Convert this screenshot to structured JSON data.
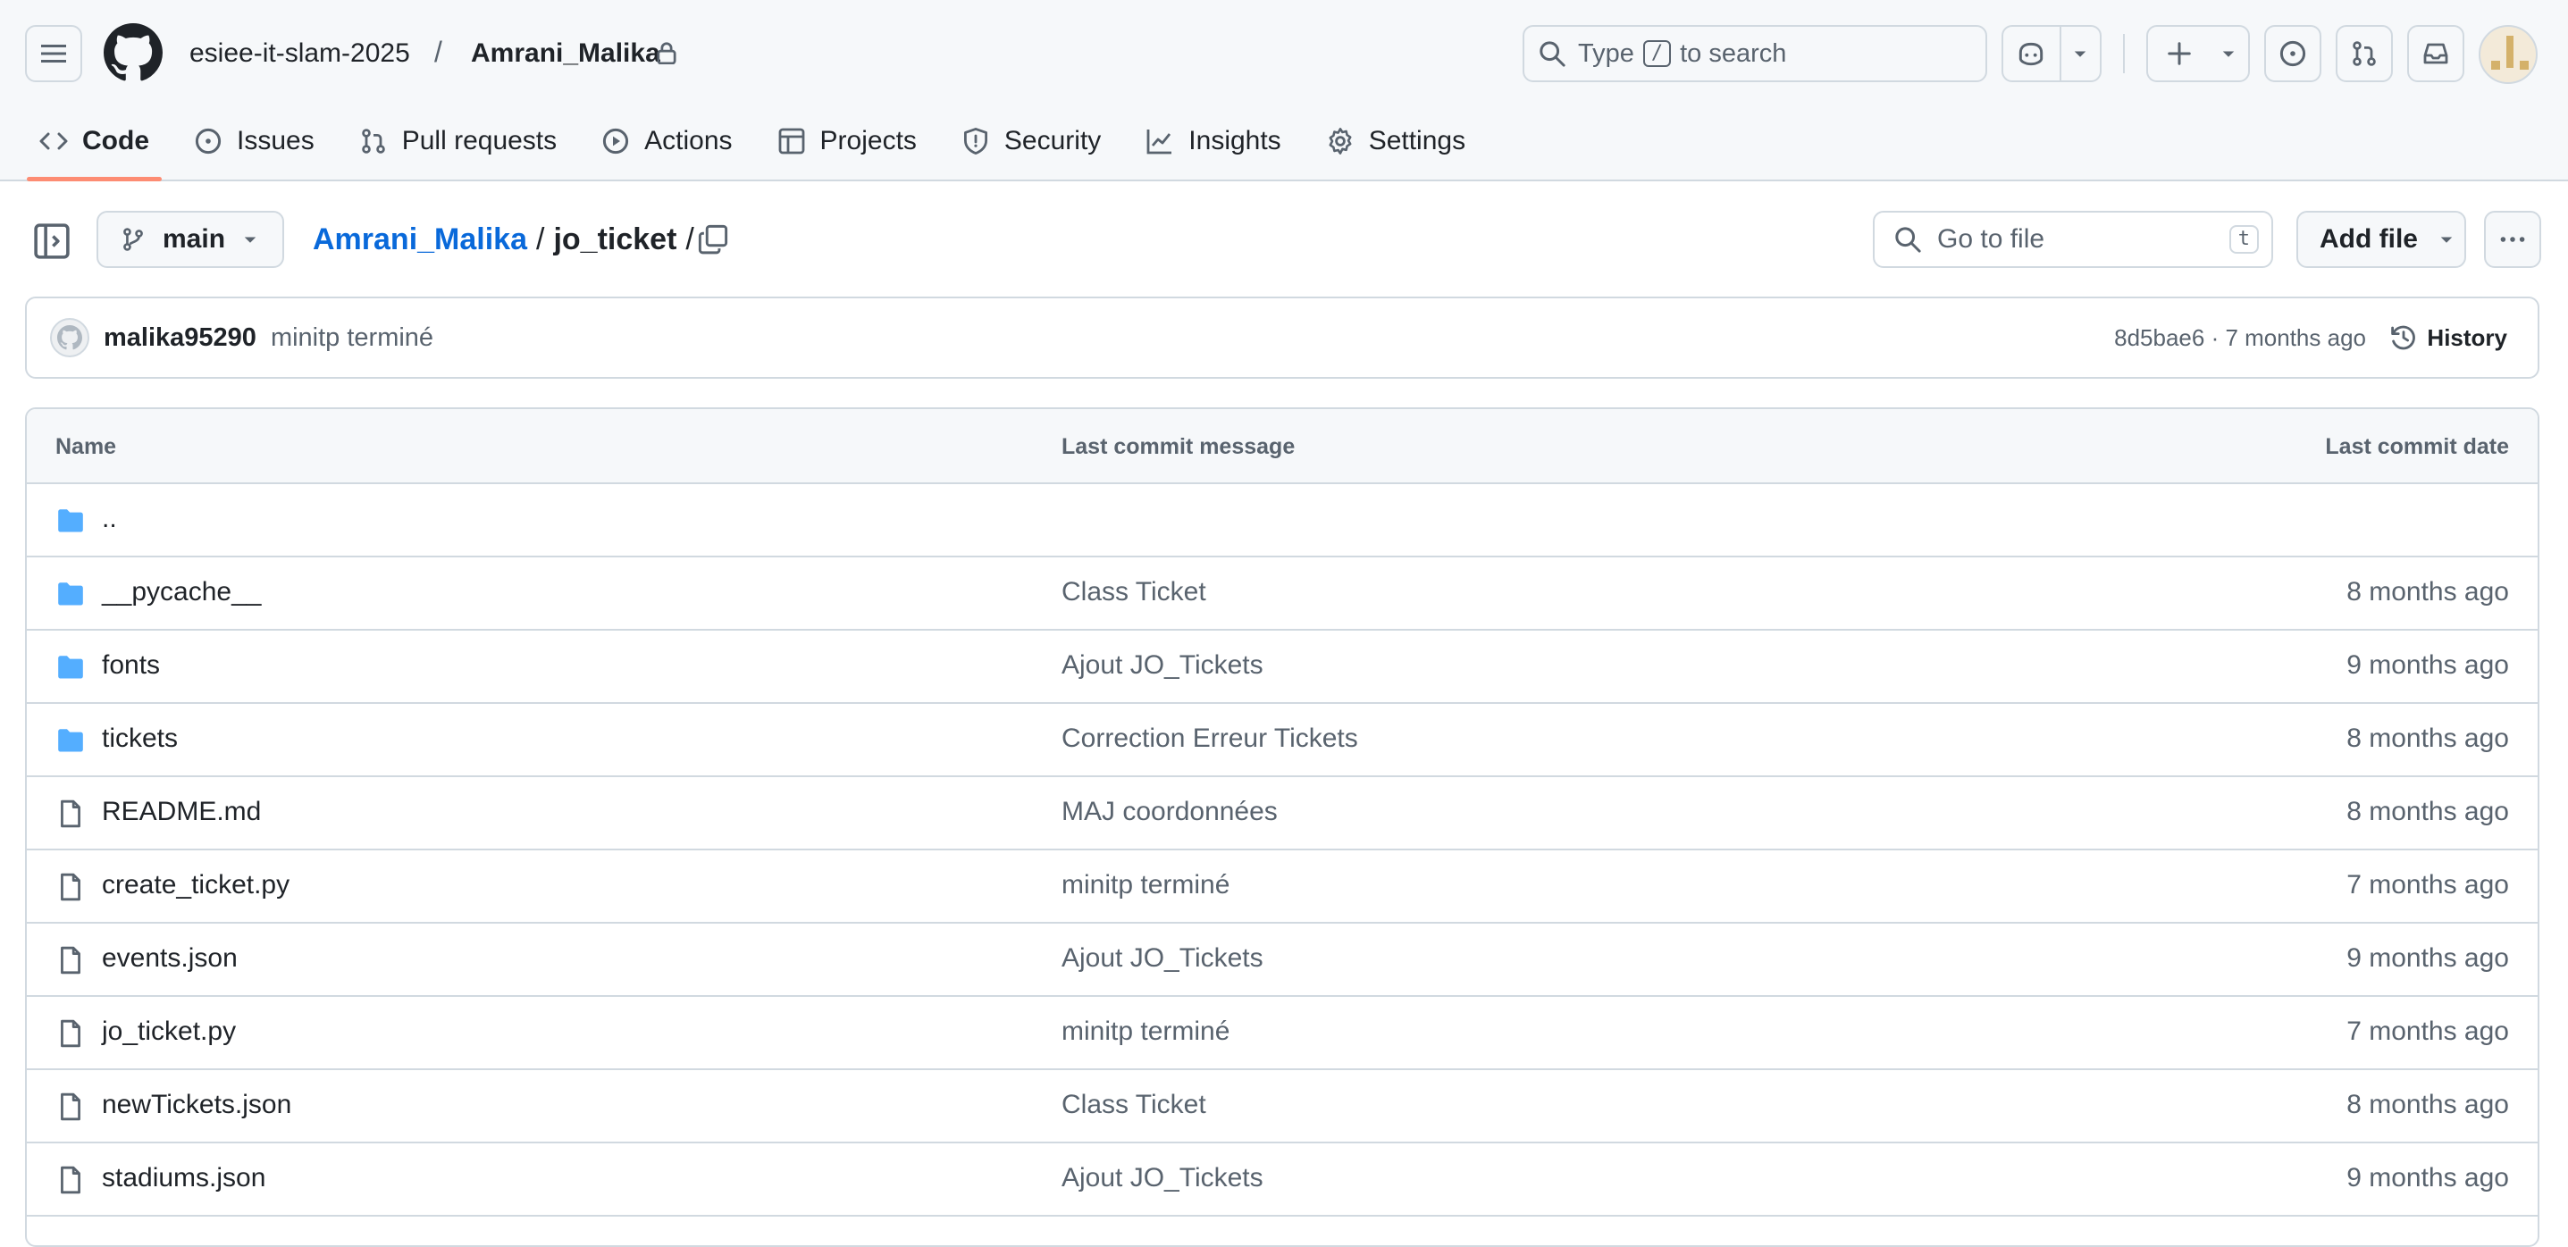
{
  "header": {
    "owner": "esiee-it-slam-2025",
    "separator": "/",
    "repo": "Amrani_Malika",
    "search_prefix": "Type",
    "search_key": "/",
    "search_suffix": "to search"
  },
  "tabs": [
    {
      "label": "Code",
      "icon": "code-icon",
      "active": true
    },
    {
      "label": "Issues",
      "icon": "issue-icon"
    },
    {
      "label": "Pull requests",
      "icon": "pull-request-icon"
    },
    {
      "label": "Actions",
      "icon": "play-icon"
    },
    {
      "label": "Projects",
      "icon": "table-icon"
    },
    {
      "label": "Security",
      "icon": "shield-icon"
    },
    {
      "label": "Insights",
      "icon": "graph-icon"
    },
    {
      "label": "Settings",
      "icon": "gear-icon"
    }
  ],
  "pathbar": {
    "branch": "main",
    "root": "Amrani_Malika",
    "folder": "jo_ticket",
    "goto_placeholder": "Go to file",
    "goto_key": "t",
    "add_file": "Add file"
  },
  "commit": {
    "author": "malika95290",
    "message": "minitp terminé",
    "meta": "8d5bae6 · 7 months ago",
    "history": "History"
  },
  "table": {
    "headers": {
      "name": "Name",
      "message": "Last commit message",
      "date": "Last commit date"
    },
    "rows": [
      {
        "name": "..",
        "type": "folder",
        "message": "",
        "date": ""
      },
      {
        "name": "__pycache__",
        "type": "folder",
        "message": "Class Ticket",
        "date": "8 months ago"
      },
      {
        "name": "fonts",
        "type": "folder",
        "message": "Ajout JO_Tickets",
        "date": "9 months ago"
      },
      {
        "name": "tickets",
        "type": "folder",
        "message": "Correction Erreur Tickets",
        "date": "8 months ago"
      },
      {
        "name": "README.md",
        "type": "file",
        "message": "MAJ coordonnées",
        "date": "8 months ago"
      },
      {
        "name": "create_ticket.py",
        "type": "file",
        "message": "minitp terminé",
        "date": "7 months ago"
      },
      {
        "name": "events.json",
        "type": "file",
        "message": "Ajout JO_Tickets",
        "date": "9 months ago"
      },
      {
        "name": "jo_ticket.py",
        "type": "file",
        "message": "minitp terminé",
        "date": "7 months ago"
      },
      {
        "name": "newTickets.json",
        "type": "file",
        "message": "Class Ticket",
        "date": "8 months ago"
      },
      {
        "name": "stadiums.json",
        "type": "file",
        "message": "Ajout JO_Tickets",
        "date": "9 months ago"
      }
    ]
  },
  "colors": {
    "accent": "#0969da",
    "folder": "#54aeff",
    "tab_underline": "#fd8c73"
  }
}
